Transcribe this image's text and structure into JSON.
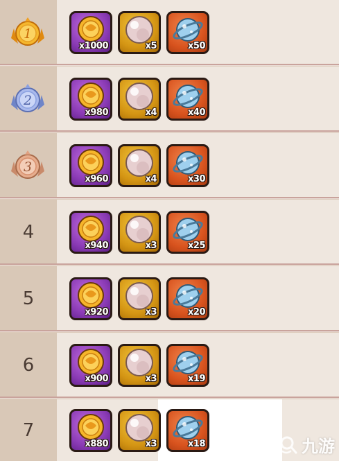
{
  "ranks": [
    {
      "label": "1",
      "medal": "gold",
      "rewards": [
        "x1000",
        "x5",
        "x50"
      ]
    },
    {
      "label": "2",
      "medal": "silver",
      "rewards": [
        "x980",
        "x4",
        "x40"
      ]
    },
    {
      "label": "3",
      "medal": "bronze",
      "rewards": [
        "x960",
        "x4",
        "x30"
      ]
    },
    {
      "label": "4",
      "medal": "",
      "rewards": [
        "x940",
        "x3",
        "x25"
      ]
    },
    {
      "label": "5",
      "medal": "",
      "rewards": [
        "x920",
        "x3",
        "x20"
      ]
    },
    {
      "label": "6",
      "medal": "",
      "rewards": [
        "x900",
        "x3",
        "x19"
      ]
    },
    {
      "label": "7",
      "medal": "",
      "rewards": [
        "x880",
        "x3",
        "x18"
      ]
    }
  ],
  "items": [
    "gold-coin-icon",
    "pearl-icon",
    "planet-orb-icon"
  ],
  "colors": {
    "gold_medal": "#f0a020",
    "silver_medal": "#8aa0e0",
    "bronze_medal": "#e0a080",
    "coin_frame": "#8b3bb5",
    "pearl_frame": "#d49514",
    "orb_frame": "#d8531e"
  },
  "watermark": {
    "text": "九游"
  }
}
